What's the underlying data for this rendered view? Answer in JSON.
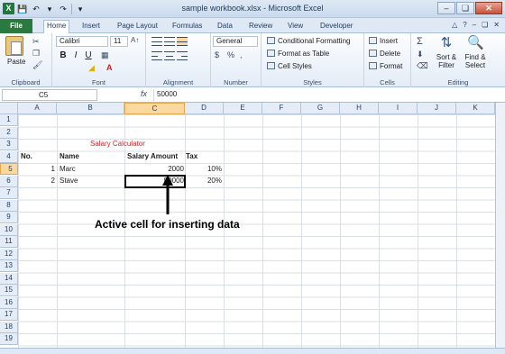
{
  "window": {
    "title": "sample workbook.xlsx - Microsoft Excel"
  },
  "ribbon": {
    "tabs": [
      "File",
      "Home",
      "Insert",
      "Page Layout",
      "Formulas",
      "Data",
      "Review",
      "View",
      "Developer"
    ],
    "active_tab": "Home",
    "clipboard": {
      "label": "Clipboard",
      "paste": "Paste"
    },
    "font": {
      "label": "Font",
      "family": "Calibri",
      "size": "11",
      "bold": "B",
      "italic": "I",
      "underline": "U"
    },
    "alignment": {
      "label": "Alignment"
    },
    "number": {
      "label": "Number",
      "format": "General",
      "currency": "$",
      "percent": "%",
      "comma": ","
    },
    "styles": {
      "label": "Styles",
      "conditional": "Conditional Formatting",
      "table": "Format as Table",
      "cell": "Cell Styles"
    },
    "cells": {
      "label": "Cells",
      "insert": "Insert",
      "delete": "Delete",
      "format": "Format"
    },
    "editing": {
      "label": "Editing",
      "sigma": "Σ",
      "sort": "Sort & Filter",
      "find": "Find & Select"
    }
  },
  "formula_bar": {
    "name_box": "C5",
    "fx": "fx",
    "value": "50000"
  },
  "columns": [
    "A",
    "B",
    "C",
    "D",
    "E",
    "F",
    "G",
    "H",
    "I",
    "J",
    "K"
  ],
  "rows": [
    "1",
    "2",
    "3",
    "4",
    "5",
    "6",
    "7",
    "8",
    "9",
    "10",
    "11",
    "12",
    "13",
    "14",
    "15",
    "16",
    "17",
    "18",
    "19"
  ],
  "sheet": {
    "title": "Salary Calculator",
    "headers": {
      "no": "No.",
      "name": "Name",
      "salary": "Salary Amount",
      "tax": "Tax"
    },
    "data": [
      {
        "no": "1",
        "name": "Marc",
        "salary": "2000",
        "tax": "10%"
      },
      {
        "no": "2",
        "name": "Stave",
        "salary": "50000",
        "tax": "20%"
      }
    ]
  },
  "annotation": "Active cell for inserting data",
  "colors": {
    "accent": "#2a7a3f",
    "title_red": "#e02020",
    "selected_header": "#f9d99f"
  }
}
